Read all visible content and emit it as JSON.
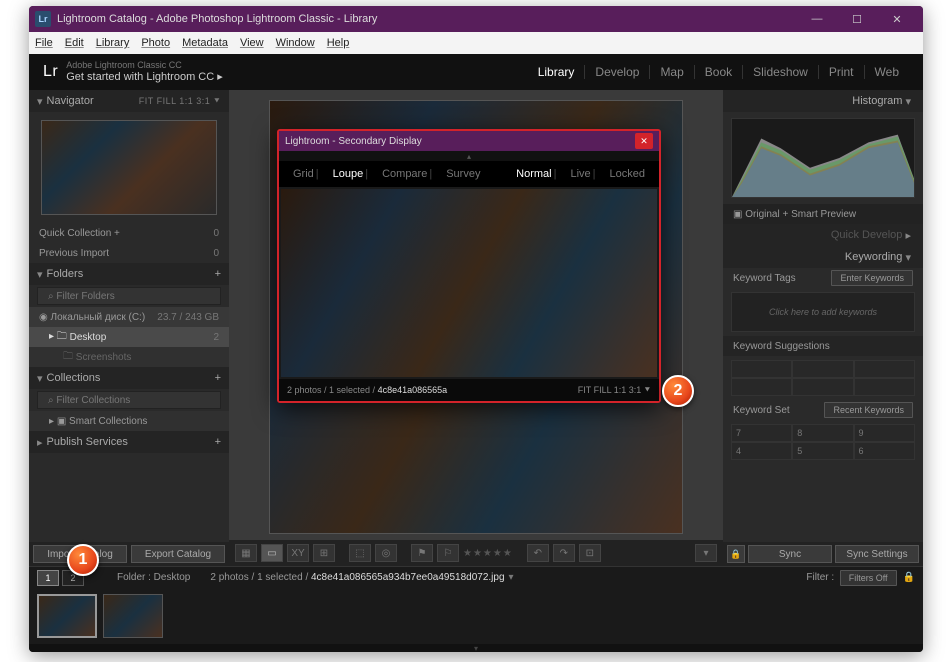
{
  "titlebar": {
    "text": "Lightroom Catalog - Adobe Photoshop Lightroom Classic - Library"
  },
  "menu": {
    "items": [
      "File",
      "Edit",
      "Library",
      "Photo",
      "Metadata",
      "View",
      "Window",
      "Help"
    ]
  },
  "identity": {
    "brand": "Lr",
    "sub": "Adobe Lightroom Classic CC",
    "main": "Get started with Lightroom CC  ▸"
  },
  "modules": {
    "items": [
      "Library",
      "Develop",
      "Map",
      "Book",
      "Slideshow",
      "Print",
      "Web"
    ],
    "active": "Library"
  },
  "navigator": {
    "title": "Navigator",
    "opts": "FIT   FILL   1:1   3:1  ⯆"
  },
  "catalog": {
    "rows": [
      {
        "label": "Quick Collection  +",
        "count": "0"
      },
      {
        "label": "Previous Import",
        "count": "0"
      }
    ]
  },
  "folders": {
    "title": "Folders",
    "filter": "Filter Folders",
    "drive": "Локальный диск (C:)",
    "driveStats": "23.7 / 243 GB",
    "items": [
      {
        "label": "Desktop",
        "count": "2"
      },
      {
        "label": "Screenshots",
        "count": ""
      }
    ]
  },
  "collections": {
    "title": "Collections",
    "filter": "Filter Collections",
    "items": [
      {
        "label": "Smart Collections"
      }
    ]
  },
  "publish": {
    "title": "Publish Services"
  },
  "importbar": {
    "import": "Import Catalog",
    "export": "Export Catalog"
  },
  "histogram": {
    "title": "Histogram",
    "status": "Original + Smart Preview"
  },
  "quickdev": {
    "title": "Quick Develop"
  },
  "keywording": {
    "title": "Keywording",
    "tagsLabel": "Keyword Tags",
    "tagsMode": "Enter Keywords",
    "placeholder": "Click here to add keywords",
    "suggestTitle": "Keyword Suggestions",
    "setTitle": "Keyword Set",
    "setMode": "Recent Keywords",
    "nums": [
      "7",
      "8",
      "9",
      "4",
      "5",
      "6"
    ]
  },
  "sync": {
    "sync": "Sync",
    "settings": "Sync Settings"
  },
  "secwin": {
    "title": "Lightroom - Secondary Display",
    "tabs": [
      "Grid",
      "Loupe",
      "Compare",
      "Survey"
    ],
    "tabsActive": "Loupe",
    "modes": [
      "Normal",
      "Live",
      "Locked"
    ],
    "modesActive": "Normal",
    "status": "2 photos / 1 selected /",
    "filename": "4c8e41a086565a",
    "zoom": "FIT   FILL   1:1   3:1  ⯆"
  },
  "filmbar": {
    "displays": [
      "1",
      "2"
    ],
    "folder": "Folder : Desktop",
    "status": "2 photos / 1 selected /",
    "filename": "4c8e41a086565a934b7ee0a49518d072.jpg",
    "filterLabel": "Filter :",
    "filterVal": "Filters Off"
  },
  "badges": {
    "one": "1",
    "two": "2"
  }
}
